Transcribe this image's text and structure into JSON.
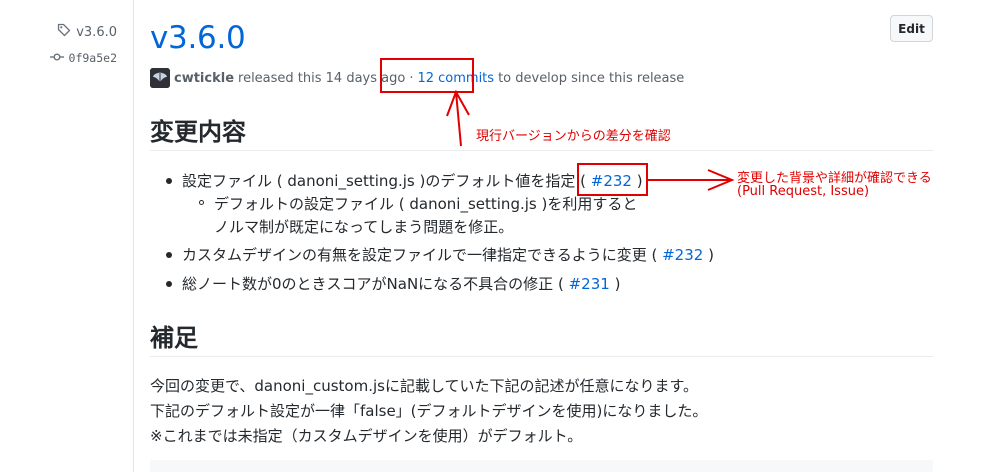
{
  "release": {
    "tag": "v3.6.0",
    "commit_sha": "0f9a5e2",
    "title": "v3.6.0",
    "edit_label": "Edit",
    "author": "cwtickle",
    "released_text": "released this 14 days ago",
    "separator": "·",
    "commits_link": "12 commits",
    "commits_suffix": "to develop since this release"
  },
  "body": {
    "changes_heading": "変更内容",
    "changes": [
      {
        "text": "設定ファイル ( danoni_setting.js )のデフォルト値を指定 (",
        "link": "#232",
        "close": ")"
      },
      {
        "text": "カスタムデザインの有無を設定ファイルで一律指定できるように変更 (",
        "link": "#232",
        "close": ")"
      },
      {
        "text": "総ノート数が0のときスコアがNaNになる不具合の修正 (",
        "link": "#231",
        "close": ")"
      }
    ],
    "sub_item_line1": "デフォルトの設定ファイル ( danoni_setting.js )を利用すると",
    "sub_item_line2": "ノルマ制が既定になってしまう問題を修正。",
    "notes_heading": "補足",
    "notes": [
      "今回の変更で、danoni_custom.jsに記載していた下記の記述が任意になります。",
      "下記のデフォルト設定が一律「false」(デフォルトデザインを使用)になりました。",
      "※これまでは未指定（カスタムデザインを使用）がデフォルト。"
    ]
  },
  "annotations": {
    "commits_note": "現行バージョンからの差分を確認",
    "pr_note_line1": "変更した背景や詳細が確認できる",
    "pr_note_line2": "(Pull Request, Issue)",
    "color": "#e00000"
  },
  "colors": {
    "link": "#0366d6",
    "text": "#24292e",
    "muted": "#586069",
    "annotation": "#e00000"
  }
}
